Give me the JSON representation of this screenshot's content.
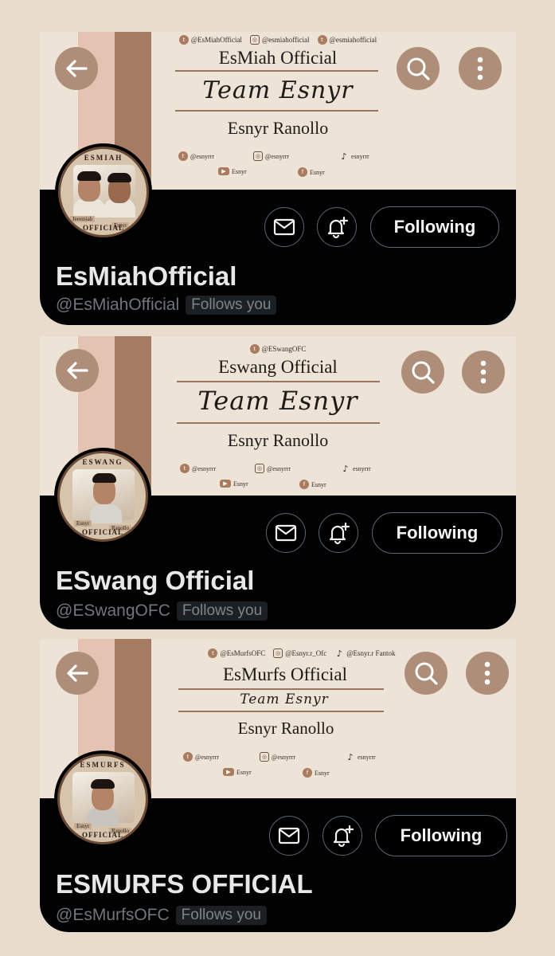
{
  "cards": [
    {
      "top_socials": [
        {
          "icon": "twitter-icon",
          "glyph": "t",
          "text": "@EsMiahOfficial"
        },
        {
          "icon": "instagram-icon",
          "glyph": "◎",
          "text": "@esmiahofficial"
        },
        {
          "icon": "twitter-icon",
          "glyph": "t",
          "text": "@esmiahofficial"
        }
      ],
      "banner_title": "EsMiah Official",
      "banner_script": "Team Esnyr",
      "banner_owner": "Esnyr Ranollo",
      "grid_socials": [
        {
          "icon": "twitter-icon",
          "glyph": "t",
          "text": "@esnyrrr"
        },
        {
          "icon": "instagram-icon",
          "glyph": "◎",
          "text": "@esnyrrr"
        },
        {
          "icon": "tiktok-icon",
          "glyph": "♪",
          "text": "esnyrrr"
        },
        {
          "icon": "youtube-icon",
          "glyph": "▶",
          "text": "Esnyr"
        },
        {
          "icon": "facebook-icon",
          "glyph": "f",
          "text": "Esnyr"
        }
      ],
      "avatar_ring_top": "ESMIAH",
      "avatar_ring_bottom": "OFFICIAL",
      "avatar_names": [
        "Jeremiah",
        "Esnyr"
      ],
      "follow_label": "Following",
      "display_name": "EsMiahOfficial",
      "handle": "@EsMiahOfficial",
      "follows_you": "Follows you"
    },
    {
      "top_socials": [
        {
          "icon": "twitter-icon",
          "glyph": "t",
          "text": "@ESwangOFC"
        }
      ],
      "banner_title": "Eswang Official",
      "banner_script": "Team Esnyr",
      "banner_owner": "Esnyr Ranollo",
      "grid_socials": [
        {
          "icon": "twitter-icon",
          "glyph": "t",
          "text": "@esnyrrr"
        },
        {
          "icon": "instagram-icon",
          "glyph": "◎",
          "text": "@esnyrrr"
        },
        {
          "icon": "tiktok-icon",
          "glyph": "♪",
          "text": "esnyrrr"
        },
        {
          "icon": "youtube-icon",
          "glyph": "▶",
          "text": "Esnyr"
        },
        {
          "icon": "facebook-icon",
          "glyph": "f",
          "text": "Esnyr"
        }
      ],
      "avatar_ring_top": "ESWANG",
      "avatar_ring_bottom": "OFFICIAL",
      "avatar_names": [
        "Esnyr",
        "Ranollo"
      ],
      "follow_label": "Following",
      "display_name": "ESwang Official",
      "handle": "@ESwangOFC",
      "follows_you": "Follows you"
    },
    {
      "top_socials": [
        {
          "icon": "twitter-icon",
          "glyph": "t",
          "text": "@EsMurfsOFC"
        },
        {
          "icon": "instagram-icon",
          "glyph": "◎",
          "text": "@Esnyr.r_Ofc"
        },
        {
          "icon": "tiktok-icon",
          "glyph": "♪",
          "text": "@Esnyr.r Fantok"
        }
      ],
      "banner_title": "EsMurfs Official",
      "banner_script": "Team Esnyr",
      "banner_owner": "Esnyr Ranollo",
      "grid_socials": [
        {
          "icon": "twitter-icon",
          "glyph": "t",
          "text": "@esnyrrr"
        },
        {
          "icon": "instagram-icon",
          "glyph": "◎",
          "text": "@esnyrrr"
        },
        {
          "icon": "tiktok-icon",
          "glyph": "♪",
          "text": "esnyrrr"
        },
        {
          "icon": "youtube-icon",
          "glyph": "▶",
          "text": "Esnyr"
        },
        {
          "icon": "facebook-icon",
          "glyph": "f",
          "text": "Esnyr"
        }
      ],
      "avatar_ring_top": "ESMURFS",
      "avatar_ring_bottom": "OFFICIAL",
      "avatar_names": [
        "Esnyr",
        "Ranollo"
      ],
      "follow_label": "Following",
      "display_name": "ESMURFS OFFICIAL",
      "handle": "@EsMurfsOFC",
      "follows_you": "Follows you"
    }
  ],
  "colors": {
    "page_bg": "#e8dccd",
    "banner_bg": "#ede3d6",
    "circle_button": "#ae8e78",
    "panel": "#020202",
    "stripe_light": "#e5c3b2",
    "stripe_dark": "#a57b62"
  }
}
